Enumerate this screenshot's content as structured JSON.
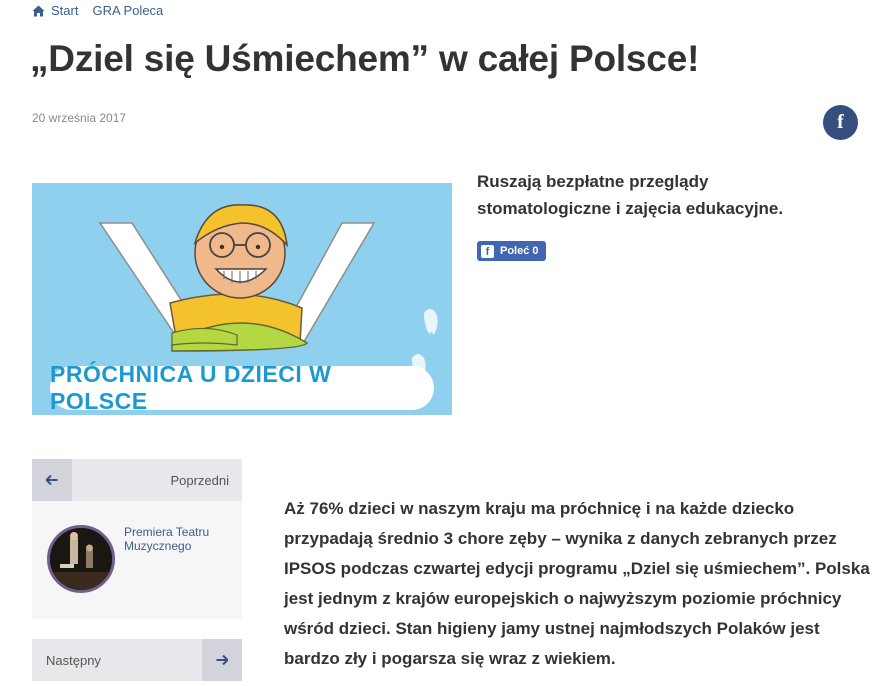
{
  "breadcrumb": {
    "home_icon": "home-icon",
    "items": [
      {
        "label": "Start"
      },
      {
        "label": "GRA Poleca"
      }
    ]
  },
  "article": {
    "title": "„Dziel się Uśmiechem” w całej Polsce!",
    "date": "20 września 2017",
    "lead": "Ruszają bezpłatne przeglądy stomatologiczne i zajęcia edukacyjne.",
    "body": "Aż 76% dzieci w naszym kraju ma próchnicę i na każde dziecko przypadają średnio 3 chore zęby – wynika z danych zebranych przez IPSOS podczas czwartej edycji programu „Dziel się uśmiechem”. Polska jest jednym z krajów europejskich o najwyższym poziomie próchnicy wśród dzieci. Stan higieny jamy ustnej najmłodszych Polaków jest bardzo zły i pogarsza się wraz z wiekiem."
  },
  "hero_image": {
    "caption": "PRÓCHNICA U DZIECI W POLSCE"
  },
  "share": {
    "facebook_icon": "facebook-icon",
    "like_label": "Poleć 0"
  },
  "navigation": {
    "previous": {
      "label": "Poprzedni",
      "post_title": "Premiera Teatru Muzycznego"
    },
    "next": {
      "label": "Następny"
    }
  },
  "colors": {
    "link": "#3a5f8c",
    "facebook_dark": "#35507e",
    "facebook_button": "#4267b2",
    "hero_background": "#8fd0ee",
    "hero_text": "#1c9ad0"
  }
}
